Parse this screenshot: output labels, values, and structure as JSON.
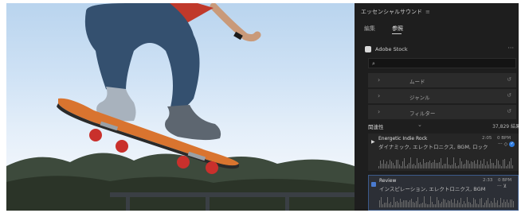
{
  "panel": {
    "title": "エッセンシャルサウンド",
    "menu_icon": "≡",
    "tabs": [
      {
        "label": "編集",
        "active": false
      },
      {
        "label": "参照",
        "active": true
      }
    ],
    "source": {
      "label": "Adobe Stock",
      "more": "···"
    },
    "search": {
      "placeholder": "",
      "icon": "search-icon"
    },
    "filters": [
      {
        "label": "ムード",
        "chevron": "›",
        "reset": "↺"
      },
      {
        "label": "ジャンル",
        "chevron": "›",
        "reset": "↺"
      },
      {
        "label": "フィルター",
        "chevron": "›",
        "reset": "↺"
      }
    ],
    "sort": {
      "label": "関連性",
      "chevron": "⌄",
      "count": "37,829 結果"
    },
    "tracks": [
      {
        "title": "Energetic Indie Rock",
        "tags": "ダイナミック, エレクトロニクス, BGM, ロック",
        "duration": "2:05",
        "bpm": "0 BPM",
        "more": "···",
        "playing": false
      },
      {
        "title": "Review",
        "tags": "インスピレーション, エレクトロニクス, BGM",
        "duration": "2:33",
        "bpm": "0 BPM",
        "more": "···",
        "playing": true
      }
    ]
  },
  "colors": {
    "panel_bg": "#1e1e1e",
    "accent": "#2f7de1"
  }
}
